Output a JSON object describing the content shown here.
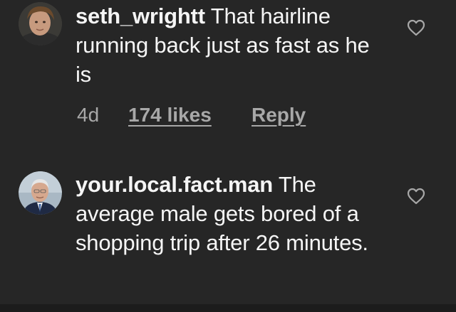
{
  "comments": [
    {
      "username": "seth_wrightt",
      "text": "That hairline running back just as fast as he is",
      "age": "4d",
      "likes": "174 likes",
      "reply": "Reply",
      "avatar_icon": "profile-photo-young-man",
      "like_icon": "heart-outline-icon"
    },
    {
      "username": "your.local.fact.man",
      "text": "The average male gets bored of a shopping trip after 26 minutes.",
      "avatar_icon": "profile-photo-older-man",
      "like_icon": "heart-outline-icon"
    }
  ],
  "colors": {
    "background": "#262626",
    "text": "#f5f5f5",
    "meta": "#a8a8a8"
  }
}
